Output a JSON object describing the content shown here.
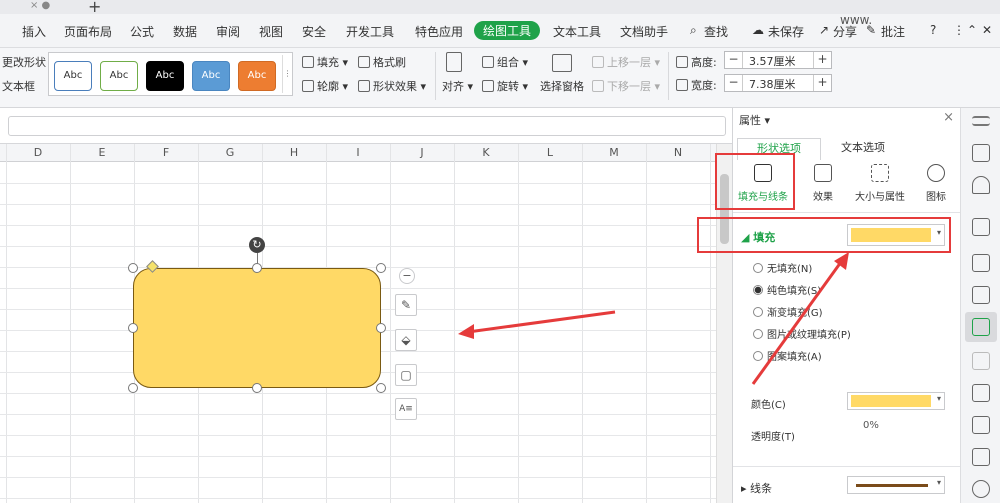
{
  "titlebar": {
    "tab_close": "× ●",
    "new_tab": "+"
  },
  "menu": {
    "items": [
      "插入",
      "页面布局",
      "公式",
      "数据",
      "审阅",
      "视图",
      "安全",
      "开发工具",
      "特色应用",
      "绘图工具",
      "文本工具",
      "文档助手"
    ],
    "search": "查找",
    "user": "www.",
    "unsaved": "未保存",
    "share": "分享",
    "comment": "批注",
    "help": "?",
    "more": "⋮",
    "collapse": "⌃",
    "close": "✕"
  },
  "ribbon": {
    "left_labels": [
      "更改形状",
      "文本框"
    ],
    "style_swatches": [
      {
        "label": "Abc",
        "bg": "#ffffff",
        "border": "#4a7ebb",
        "color": "#333333"
      },
      {
        "label": "Abc",
        "bg": "#ffffff",
        "border": "#70ad47",
        "color": "#333333"
      },
      {
        "label": "Abc",
        "bg": "#000000",
        "border": "#000000",
        "color": "#ffffff"
      },
      {
        "label": "Abc",
        "bg": "#5b9bd5",
        "border": "#4a86c0",
        "color": "#ffffff"
      },
      {
        "label": "Abc",
        "bg": "#ed7d31",
        "border": "#d06a24",
        "color": "#ffffff"
      }
    ],
    "fill": "填充",
    "format_brush": "格式刷",
    "outline": "轮廓",
    "shape_effect": "形状效果",
    "align": "对齐",
    "group": "组合",
    "rotate": "旋转",
    "selection_pane": "选择窗格",
    "bring_forward": "上移一层",
    "send_backward": "下移一层",
    "height_label": "高度:",
    "height_value": "3.57厘米",
    "width_label": "宽度:",
    "width_value": "7.38厘米",
    "minus": "−",
    "plus": "+"
  },
  "sheet": {
    "columns": [
      "D",
      "E",
      "F",
      "G",
      "H",
      "I",
      "J",
      "K",
      "L",
      "M",
      "N"
    ],
    "shape_fill": "#ffd966",
    "float_buttons": [
      "−",
      "✎",
      "⬙",
      "▢",
      "A≡"
    ]
  },
  "panel": {
    "title": "属性",
    "tabs": [
      "形状选项",
      "文本选项"
    ],
    "sub": [
      "填充与线条",
      "效果",
      "大小与属性",
      "图标"
    ],
    "fill_section": "填充",
    "fill_color": "#ffd966",
    "options": [
      "无填充(N)",
      "纯色填充(S)",
      "渐变填充(G)",
      "图片或纹理填充(P)",
      "图案填充(A)"
    ],
    "selected_option": 1,
    "color_label": "颜色(C)",
    "transparency_label": "透明度(T)",
    "transparency_value": "0%",
    "line_section": "线条",
    "line_color": "#7a4b1a",
    "close": "×"
  },
  "accent": {
    "green": "#1fa249",
    "red": "#e53b3b"
  }
}
